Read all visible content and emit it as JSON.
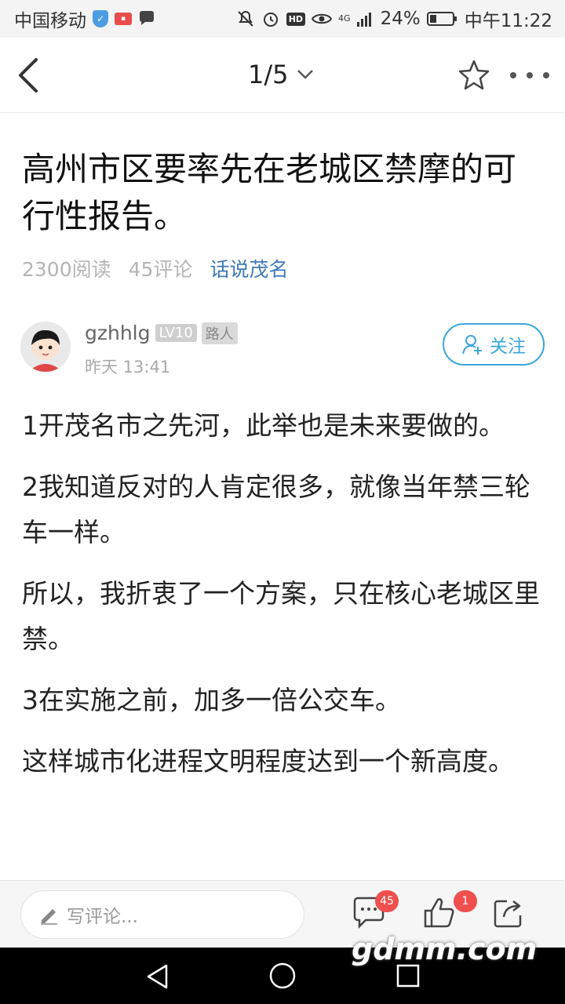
{
  "status_bar": {
    "carrier": "中国移动",
    "network": "4G",
    "battery": "24%",
    "time": "中午11:22"
  },
  "nav": {
    "pager": "1/5"
  },
  "article": {
    "title": "高州市区要率先在老城区禁摩的可行性报告。",
    "reads": "2300阅读",
    "comments": "45评论",
    "channel": "话说茂名"
  },
  "author": {
    "name": "gzhhlg",
    "level": "LV10",
    "tag": "路人",
    "time": "昨天 13:41",
    "follow_label": "关注"
  },
  "content": {
    "paragraphs": [
      "1开茂名市之先河，此举也是未来要做的。",
      "2我知道反对的人肯定很多，就像当年禁三轮车一样。",
      "所以，我折衷了一个方案，只在核心老城区里禁。",
      "3在实施之前，加多一倍公交车。",
      "这样城市化进程文明程度达到一个新高度。"
    ]
  },
  "bottom_bar": {
    "comment_placeholder": "写评论...",
    "comment_count": "45",
    "like_count": "1"
  },
  "watermark": "gdmm.com"
}
